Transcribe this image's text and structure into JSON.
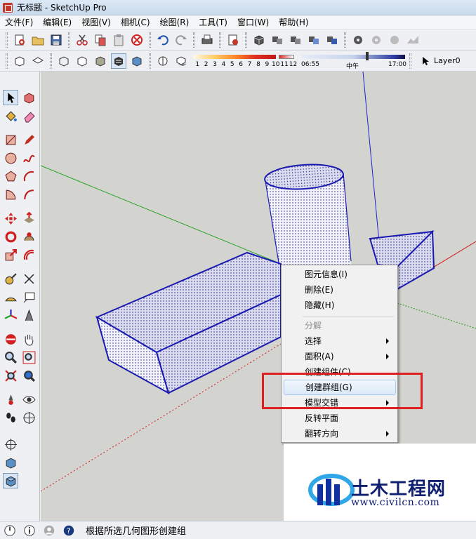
{
  "window": {
    "title": "无标题 - SketchUp Pro"
  },
  "menubar": {
    "items": [
      "文件(F)",
      "编辑(E)",
      "视图(V)",
      "相机(C)",
      "绘图(R)",
      "工具(T)",
      "窗口(W)",
      "帮助(H)"
    ]
  },
  "toolbar": {
    "shadow_scale_numbers": [
      "1",
      "2",
      "3",
      "4",
      "5",
      "6",
      "7",
      "8",
      "9",
      "10",
      "11",
      "12"
    ],
    "time_start": "06:55",
    "time_mid": "中午",
    "time_end": "17:00",
    "layer": "Layer0"
  },
  "context_menu": {
    "items": [
      {
        "label": "图元信息(I)",
        "enabled": true,
        "submenu": false
      },
      {
        "label": "删除(E)",
        "enabled": true,
        "submenu": false
      },
      {
        "label": "隐藏(H)",
        "enabled": true,
        "submenu": false
      },
      {
        "label": "分解",
        "enabled": false,
        "submenu": false
      },
      {
        "label": "选择",
        "enabled": true,
        "submenu": true
      },
      {
        "label": "面积(A)",
        "enabled": true,
        "submenu": true
      },
      {
        "label": "创建组件(C)...",
        "enabled": true,
        "submenu": false
      },
      {
        "label": "创建群组(G)",
        "enabled": true,
        "submenu": false,
        "highlighted": true
      },
      {
        "label": "模型交错",
        "enabled": true,
        "submenu": true
      },
      {
        "label": "反转平面",
        "enabled": true,
        "submenu": false
      },
      {
        "label": "翻转方向",
        "enabled": true,
        "submenu": true
      }
    ]
  },
  "status": {
    "text": "根据所选几何图形创建组"
  },
  "watermark": {
    "title": "土木工程网",
    "url": "www.civilcn.com"
  },
  "colors": {
    "highlight_box": "#e02020",
    "selection_edge": "#1a1ab0",
    "axis_red": "#d02020",
    "axis_green": "#20a020",
    "axis_blue": "#2020d0",
    "viewport_bg": "#d3d3cf",
    "watermark_text": "#102070"
  },
  "icons": {
    "left_tools": [
      "select-arrow-icon",
      "make-component-icon",
      "paint-bucket-icon",
      "eraser-icon",
      "rectangle-icon",
      "pencil-icon",
      "circle-icon",
      "freehand-icon",
      "polygon-icon",
      "arc-icon",
      "pie-icon",
      "three-point-arc-icon",
      "move-icon",
      "push-pull-icon",
      "rotate-icon",
      "follow-me-icon",
      "scale-icon",
      "offset-icon",
      "tape-measure-icon",
      "dimension-icon",
      "protractor-icon",
      "text-icon",
      "axes-icon",
      "3d-text-icon",
      "orbit-icon",
      "pan-icon",
      "zoom-icon",
      "zoom-window-icon",
      "zoom-extents-icon",
      "previous-view-icon",
      "position-camera-icon",
      "look-around-icon",
      "walk-icon",
      "section-plane-icon",
      "standard-view-icon",
      "iso-view-icon",
      "top-view-icon"
    ]
  }
}
